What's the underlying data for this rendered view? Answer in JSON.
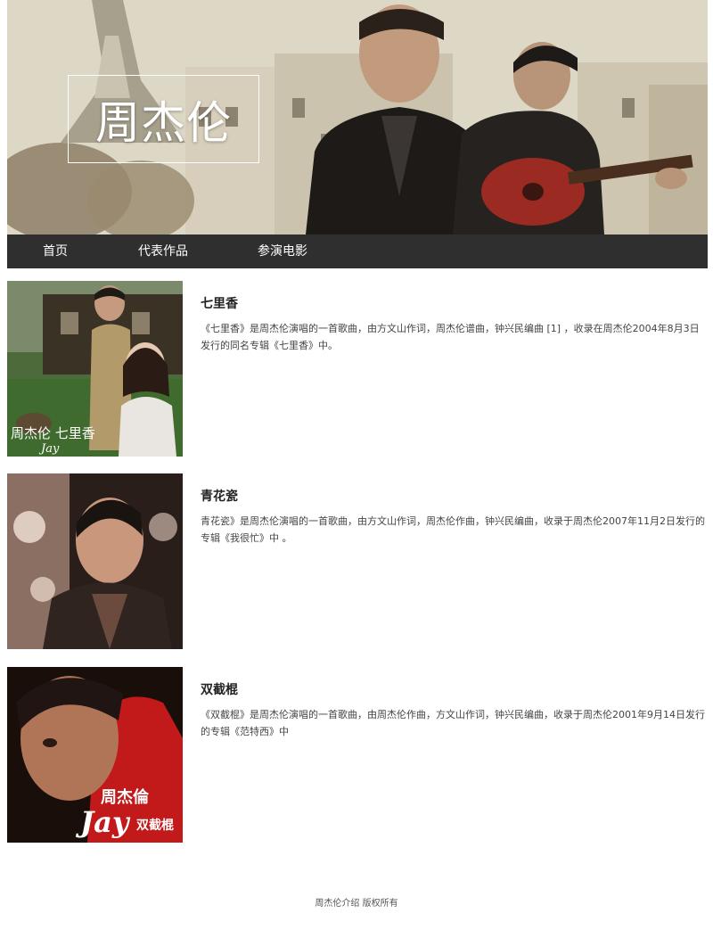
{
  "banner": {
    "title": "周杰伦"
  },
  "nav": {
    "items": [
      {
        "label": "首页"
      },
      {
        "label": "代表作品"
      },
      {
        "label": "参演电影"
      }
    ]
  },
  "songs": [
    {
      "title": "七里香",
      "description": "《七里香》是周杰伦演唱的一首歌曲，由方文山作词，周杰伦谱曲，钟兴民编曲 [1] ，收录在周杰伦2004年8月3日发行的同名专辑《七里香》中。",
      "cover_text": "周杰伦 七里香 Jay"
    },
    {
      "title": "青花瓷",
      "description": "青花瓷》是周杰伦演唱的一首歌曲，由方文山作词，周杰伦作曲，钟兴民编曲，收录于周杰伦2007年11月2日发行的专辑《我很忙》中 。"
    },
    {
      "title": "双截棍",
      "description": "《双截棍》是周杰伦演唱的一首歌曲，由周杰伦作曲，方文山作词，钟兴民编曲，收录于周杰伦2001年9月14日发行的专辑《范特西》中",
      "cover_text": "周杰倫 Jay 双截棍"
    }
  ],
  "footer": {
    "text": "周杰伦介绍 版权所有"
  }
}
